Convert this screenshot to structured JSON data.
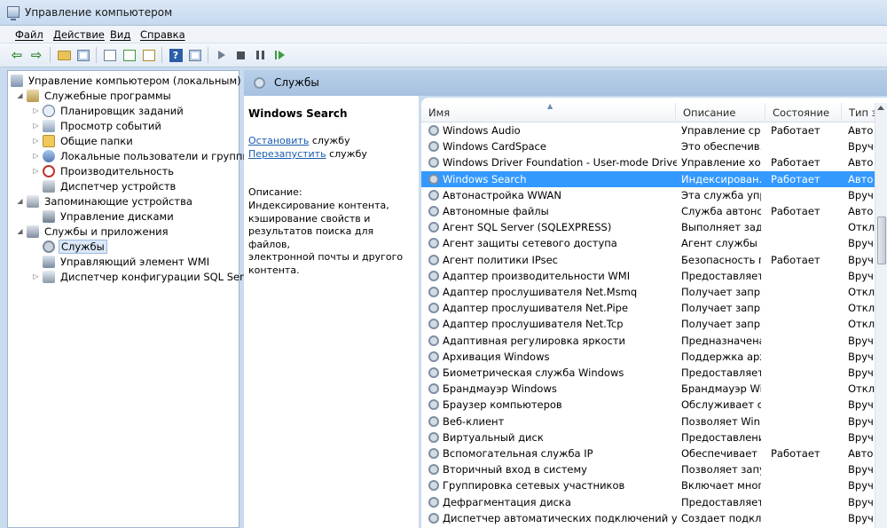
{
  "window": {
    "title": "Управление компьютером"
  },
  "menu": [
    "Файл",
    "Действие",
    "Вид",
    "Справка"
  ],
  "toolbar": {
    "buttons": [
      "back-icon",
      "forward-icon",
      "up-folder-icon",
      "show-tree-icon",
      "properties-icon",
      "refresh-icon",
      "export-icon",
      "help-icon",
      "show-action-pane-icon",
      "start-icon",
      "stop-icon",
      "pause-icon",
      "restart-icon"
    ]
  },
  "tree": {
    "root": "Управление компьютером (локальным)",
    "items": [
      {
        "label": "Служебные программы",
        "icon": "tools-icon"
      },
      {
        "label": "Планировщик заданий",
        "icon": "clock-icon"
      },
      {
        "label": "Просмотр событий",
        "icon": "events-icon"
      },
      {
        "label": "Общие папки",
        "icon": "folder-icon"
      },
      {
        "label": "Локальные пользователи и группы",
        "icon": "users-icon"
      },
      {
        "label": "Производительность",
        "icon": "performance-icon"
      },
      {
        "label": "Диспетчер устройств",
        "icon": "devices-icon"
      },
      {
        "label": "Запоминающие устройства",
        "icon": "storage-icon"
      },
      {
        "label": "Управление дисками",
        "icon": "disks-icon"
      },
      {
        "label": "Службы и приложения",
        "icon": "apps-icon"
      },
      {
        "label": "Службы",
        "icon": "gear-icon"
      },
      {
        "label": "Управляющий элемент WMI",
        "icon": "wmi-icon"
      },
      {
        "label": "Диспетчер конфигурации SQL Server",
        "icon": "sql-icon"
      }
    ]
  },
  "main": {
    "header_title": "Службы",
    "details": {
      "service_name": "Windows Search",
      "stop_link": "Остановить",
      "restart_link": "Перезапустить",
      "link_suffix": "службу",
      "description_label": "Описание:",
      "description_lines": [
        "Индексирование контента,",
        "кэширование свойств и",
        "результатов поиска для файлов,",
        "электронной почты и другого",
        "контента."
      ]
    },
    "columns": [
      "Имя",
      "Описание",
      "Состояние",
      "Тип з"
    ],
    "rows": [
      {
        "name": "Windows Audio",
        "desc": "Управление ср...",
        "status": "Работает",
        "type": "Авто"
      },
      {
        "name": "Windows CardSpace",
        "desc": "Это обеспечив...",
        "status": "",
        "type": "Вруч"
      },
      {
        "name": "Windows Driver Foundation - User-mode Driver Fr...",
        "desc": "Управление хо...",
        "status": "Работает",
        "type": "Авто"
      },
      {
        "name": "Windows Search",
        "desc": "Индексирован...",
        "status": "Работает",
        "type": "Авто"
      },
      {
        "name": "Автонастройка WWAN",
        "desc": "Эта служба упр...",
        "status": "",
        "type": "Вруч"
      },
      {
        "name": "Автономные файлы",
        "desc": "Служба автоно...",
        "status": "Работает",
        "type": "Авто"
      },
      {
        "name": "Агент SQL Server (SQLEXPRESS)",
        "desc": "Выполняет зад...",
        "status": "",
        "type": "Откл"
      },
      {
        "name": "Агент защиты сетевого доступа",
        "desc": "Агент службы ...",
        "status": "",
        "type": "Вруч"
      },
      {
        "name": "Агент политики IPsec",
        "desc": "Безопасность п...",
        "status": "Работает",
        "type": "Вруч"
      },
      {
        "name": "Адаптер производительности WMI",
        "desc": "Предоставляет ...",
        "status": "",
        "type": "Вруч"
      },
      {
        "name": "Адаптер прослушивателя Net.Msmq",
        "desc": "Получает запр...",
        "status": "",
        "type": "Откл"
      },
      {
        "name": "Адаптер прослушивателя Net.Pipe",
        "desc": "Получает запр...",
        "status": "",
        "type": "Откл"
      },
      {
        "name": "Адаптер прослушивателя Net.Tcp",
        "desc": "Получает запр...",
        "status": "",
        "type": "Откл"
      },
      {
        "name": "Адаптивная регулировка яркости",
        "desc": "Предназначена...",
        "status": "",
        "type": "Вруч"
      },
      {
        "name": "Архивация Windows",
        "desc": "Поддержка арх...",
        "status": "",
        "type": "Вруч"
      },
      {
        "name": "Биометрическая служба Windows",
        "desc": "Предоставляет ...",
        "status": "",
        "type": "Вруч"
      },
      {
        "name": "Брандмауэр Windows",
        "desc": "Брандмауэр Wi...",
        "status": "",
        "type": "Откл"
      },
      {
        "name": "Браузер компьютеров",
        "desc": "Обслуживает с...",
        "status": "",
        "type": "Вруч"
      },
      {
        "name": "Веб-клиент",
        "desc": "Позволяет Win...",
        "status": "",
        "type": "Вруч"
      },
      {
        "name": "Виртуальный диск",
        "desc": "Предоставлени...",
        "status": "",
        "type": "Вруч"
      },
      {
        "name": "Вспомогательная служба IP",
        "desc": "Обеспечивает ...",
        "status": "Работает",
        "type": "Авто"
      },
      {
        "name": "Вторичный вход в систему",
        "desc": "Позволяет запу...",
        "status": "",
        "type": "Вруч"
      },
      {
        "name": "Группировка сетевых участников",
        "desc": "Включает мног...",
        "status": "",
        "type": "Вруч"
      },
      {
        "name": "Дефрагментация диска",
        "desc": "Предоставляет ...",
        "status": "",
        "type": "Вруч"
      },
      {
        "name": "Диспетчер автоматических подключений удале...",
        "desc": "Создает подкл...",
        "status": "",
        "type": "Вруч"
      }
    ],
    "selected_row": 3
  },
  "colors": {
    "selection": "#3399ff",
    "link": "#1a5cb0",
    "header_band": "#b9cfe8"
  }
}
